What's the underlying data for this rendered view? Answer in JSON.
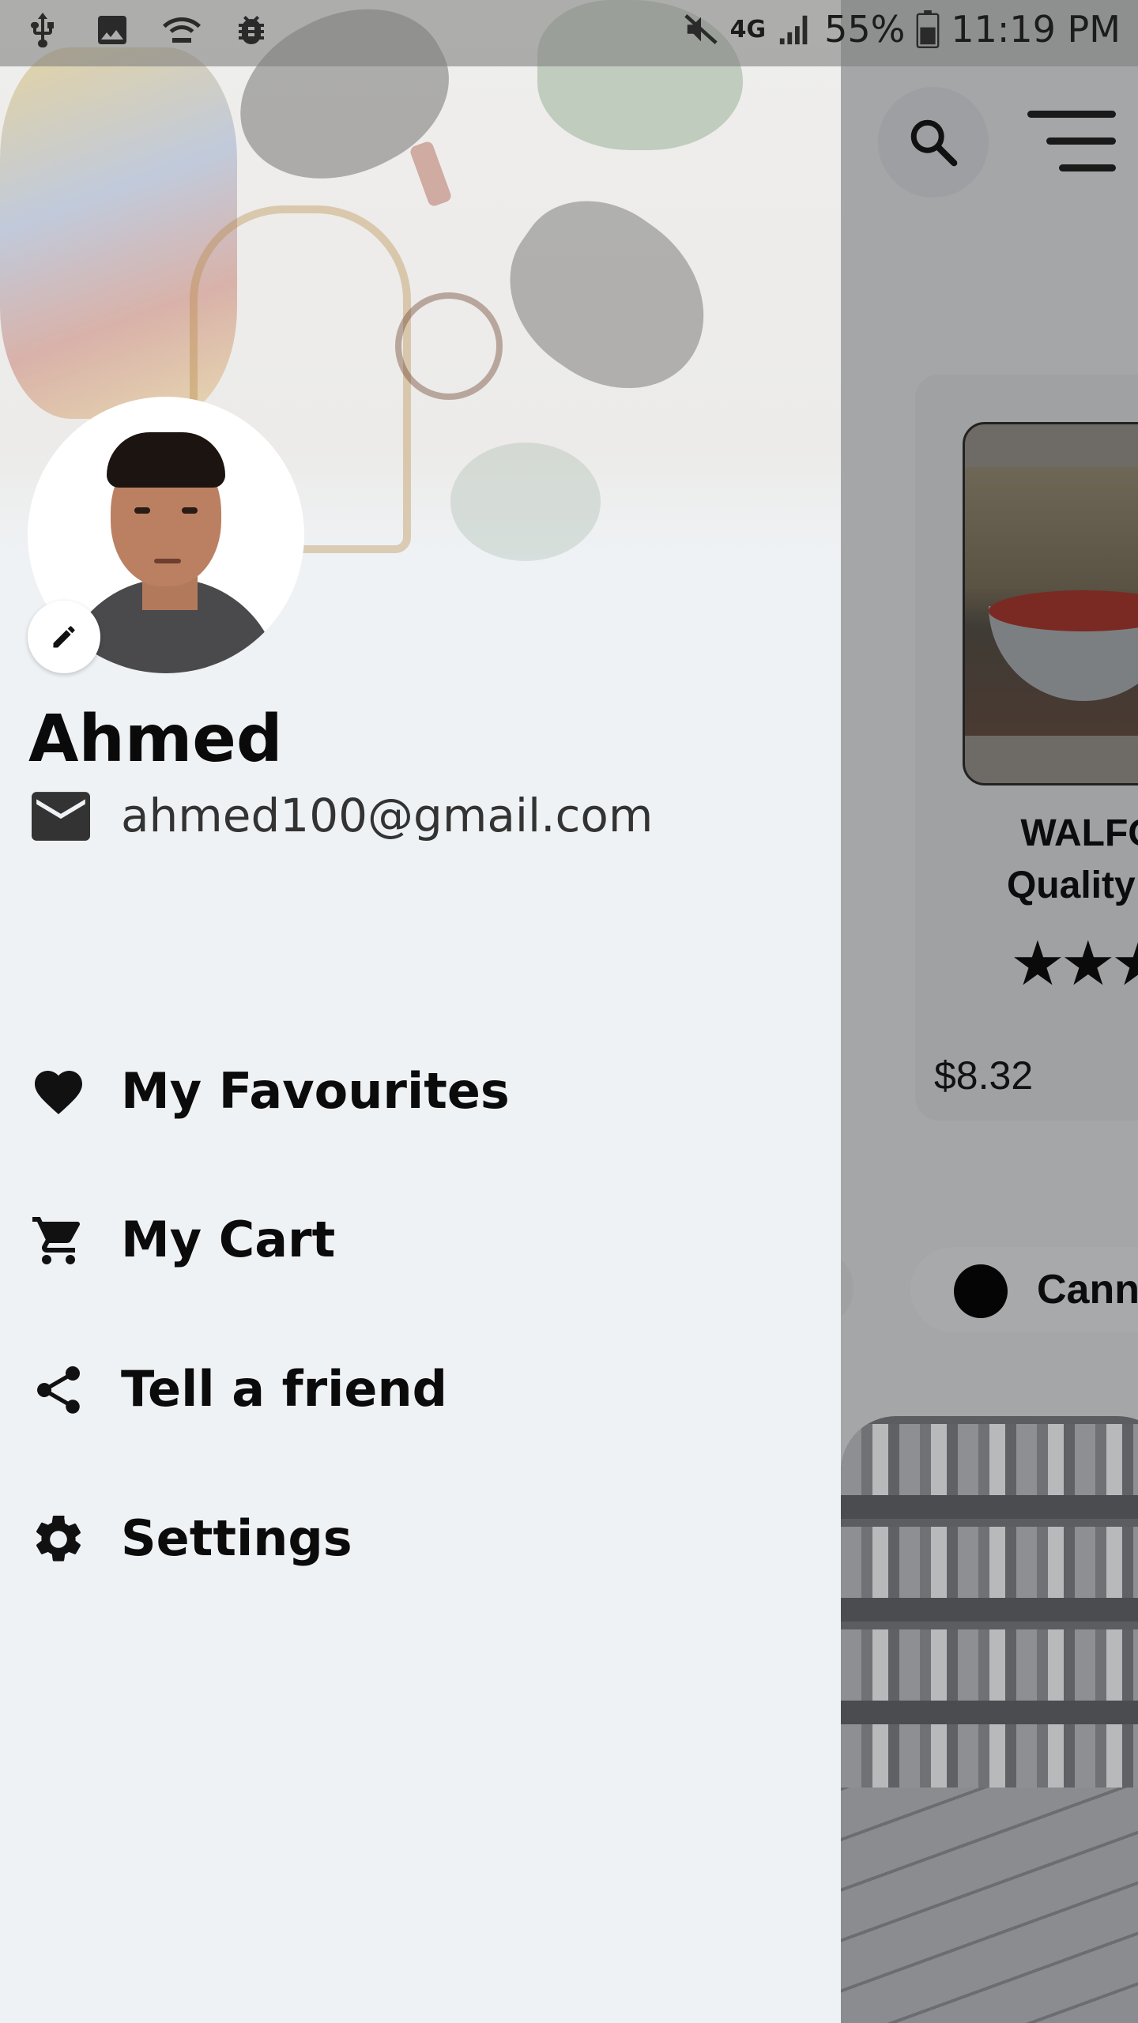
{
  "status_bar": {
    "network": "4G",
    "battery": "55%",
    "time": "11:19 PM"
  },
  "background_app": {
    "product": {
      "title_line1": "WALFO",
      "title_line2": "Quality S",
      "rating_stars": 3,
      "price": "$8.32"
    },
    "category_chip_label": "Cann"
  },
  "drawer": {
    "user_name": "Ahmed",
    "user_email": "ahmed100@gmail.com",
    "menu_items": [
      {
        "label": "My Favourites",
        "icon": "heart-icon"
      },
      {
        "label": "My Cart",
        "icon": "cart-icon"
      },
      {
        "label": "Tell a friend",
        "icon": "share-icon"
      },
      {
        "label": "Settings",
        "icon": "gear-icon"
      }
    ]
  },
  "colors": {
    "drawer_background": "#eff2f5",
    "scrim": "#a4a6a8",
    "text_primary": "#0b0b0b"
  }
}
